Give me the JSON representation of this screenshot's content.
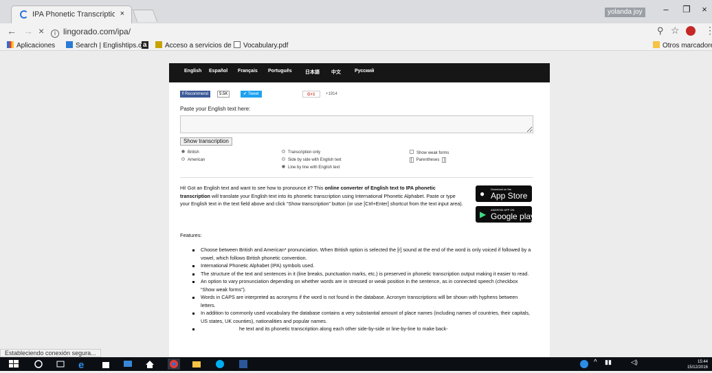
{
  "browser": {
    "tab_title": "IPA Phonetic Transcriptio",
    "tab_close": "×",
    "user_label": "yolanda joy",
    "window_controls": {
      "minimize": "–",
      "restore": "❐",
      "close": "×"
    },
    "nav": {
      "back": "←",
      "forward": "→",
      "stop": "×",
      "url": "lingorado.com/ipa/"
    },
    "toolbar_icons": {
      "zoom": "⚲",
      "star": "☆",
      "menu": "⋮"
    },
    "bookmarks": {
      "left": [
        {
          "label": "Aplicaciones",
          "icon": "apps-grid-icon"
        },
        {
          "label": "Search | Englishtips.or",
          "icon": "englishtips-icon"
        },
        {
          "label": "a",
          "icon": "amazon-icon"
        },
        {
          "label": "Acceso a servicios de",
          "icon": "bank-icon"
        },
        {
          "label": "Vocabulary.pdf",
          "icon": "document-icon"
        }
      ],
      "right": {
        "label": "Otros marcadores",
        "icon": "folder-icon"
      }
    },
    "status_text": "Estableciendo conexión segura..."
  },
  "site": {
    "languages": [
      "English",
      "Español",
      "Français",
      "Português",
      "日本語",
      "中文",
      "Русский"
    ],
    "social": {
      "recommend_label": "Recommend",
      "recommend_count": "5.5K",
      "tweet_label": "Tweet",
      "gplus_label": "G+1",
      "gplus_count": "+1914"
    },
    "paste_label": "Paste your English text here:",
    "textarea_value": "",
    "show_button": "Show transcription",
    "accent_options": [
      {
        "label": "British",
        "selected": true
      },
      {
        "label": "American",
        "selected": false
      }
    ],
    "display_options": [
      {
        "label": "Transcription only",
        "selected": false
      },
      {
        "label": "Side by side with English text",
        "selected": false
      },
      {
        "label": "Line by line with English text",
        "selected": true
      }
    ],
    "weak_forms_label": "Show weak forms",
    "parentheses_label": "Parentheses",
    "intro_lead": "Hi! Got an English text and want to see how to pronounce it? This ",
    "intro_bold": "online converter of English text to IPA phonetic transcription",
    "intro_tail": " will translate your English text into its phonetic transcription using International Phonetic Alphabet. Paste or type your English text in the text field above and click “Show transcription” button (or use [Ctrl+Enter] shortcut from the text input area).",
    "appstore": {
      "small": "Download on the",
      "big": "App Store"
    },
    "googleplay": {
      "small": "ANDROID APP ON",
      "big": "Google play"
    },
    "features_heading": "Features:",
    "features": [
      "Choose between British and American* pronunciation. When British option is selected the [r] sound at the end of the word is only voiced if followed by a vowel, which follows British phonetic convention.",
      "International Phonetic Alphabet (IPA) symbols used.",
      "The structure of the text and sentences in it (line breaks, punctuation marks, etc.) is preserved in phonetic transcription output making it easier to read.",
      "An option to vary pronunciation depending on whether words are in stressed or weak position in the sentence, as in connected speech (checkbox “Show weak forms”).",
      "Words in CAPS are interpreted as acronyms if the word is not found in the database. Acronym transcriptions will be shown with hyphens between letters.",
      "In addition to commonly used vocabulary the database contains a very substantial amount of place names (including names of countries, their capitals, US states, UK counties), nationalities and popular names.",
      "he text and its phonetic transcription along each other side-by-side or line-by-line to make back-"
    ]
  },
  "taskbar": {
    "time": "15:44",
    "date": "15/12/2016",
    "icons": [
      "windows-start-icon",
      "search-icon",
      "task-view-icon",
      "edge-icon",
      "store-icon",
      "monitor-icon",
      "home-icon",
      "chrome-icon",
      "file-explorer-icon",
      "skype-icon",
      "word-icon"
    ]
  }
}
